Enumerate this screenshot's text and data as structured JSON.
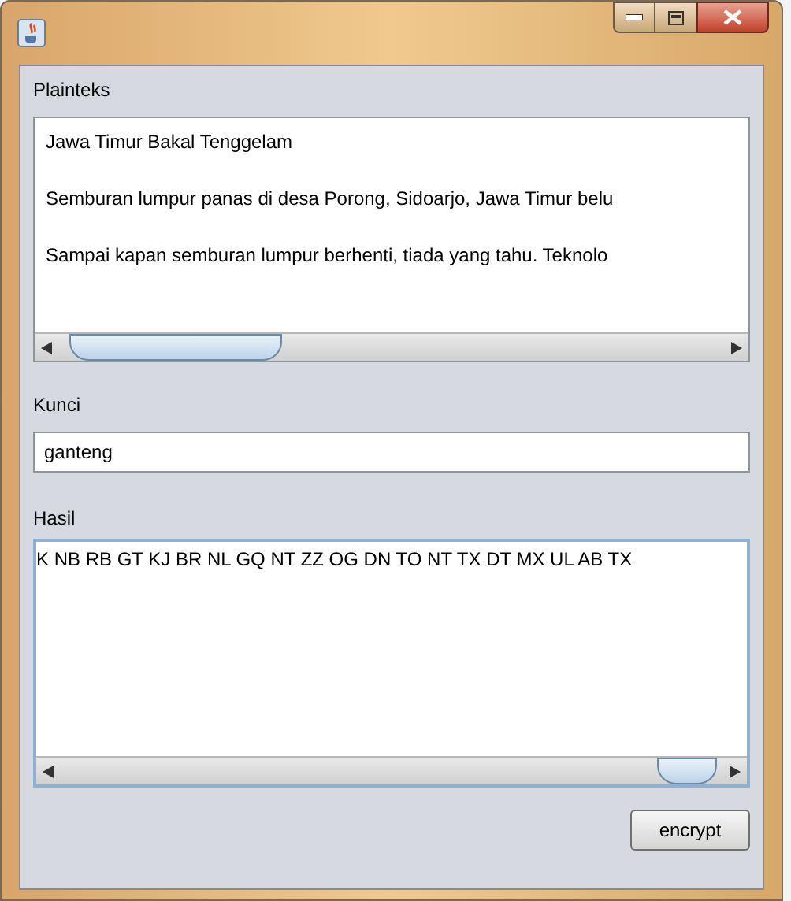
{
  "plaintext": {
    "label": "Plainteks",
    "lines": [
      "Jawa Timur Bakal Tenggelam",
      "Semburan lumpur panas di desa Porong, Sidoarjo, Jawa Timur belu",
      "Sampai kapan semburan lumpur berhenti, tiada yang tahu. Teknolo"
    ]
  },
  "key": {
    "label": "Kunci",
    "value": "ganteng"
  },
  "result": {
    "label": "Hasil",
    "text": "K NB RB GT KJ BR NL GQ NT ZZ OG DN TO NT TX DT MX UL AB TX"
  },
  "button": {
    "label": "encrypt"
  }
}
